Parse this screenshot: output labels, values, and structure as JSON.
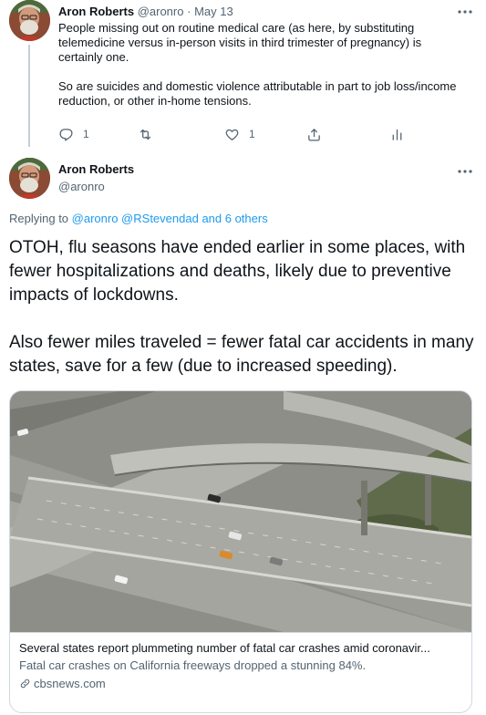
{
  "parent_tweet": {
    "author_name": "Aron Roberts",
    "handle": "@aronro",
    "separator": "·",
    "date": "May 13",
    "paragraphs": [
      "People missing out on routine medical care (as here, by substituting telemedicine versus in-person visits in third trimester of pregnancy) is certainly one.",
      "So are suicides and domestic violence attributable in part to job loss/income reduction, or other in-home tensions."
    ],
    "actions": {
      "reply_count": "1",
      "retweet_count": "",
      "like_count": "1"
    }
  },
  "reply_tweet": {
    "author_name": "Aron Roberts",
    "handle": "@aronro",
    "replying_prefix": "Replying to",
    "replying_users": "@aronro @RStevendad",
    "replying_others": "and 6 others",
    "paragraphs": [
      "OTOH, flu seasons have ended earlier in some places, with fewer hospitalizations and deaths, likely due to preventive impacts of lockdowns.",
      "Also fewer miles traveled = fewer fatal car accidents in many states, save for a few (due to increased speeding)."
    ],
    "card": {
      "title": "Several states report plummeting number of fatal car crashes amid coronavir...",
      "description": "Fatal car crashes on California freeways dropped a stunning 84%.",
      "domain": "cbsnews.com"
    }
  },
  "icons": {
    "more": "more-horizontal-icon",
    "reply": "reply-icon",
    "retweet": "retweet-icon",
    "like": "heart-icon",
    "share": "share-icon",
    "analytics": "analytics-icon",
    "link": "link-icon"
  },
  "colors": {
    "link": "#1d9bf0",
    "muted": "#536471",
    "text": "#0f1419",
    "border": "#cfd9de"
  }
}
